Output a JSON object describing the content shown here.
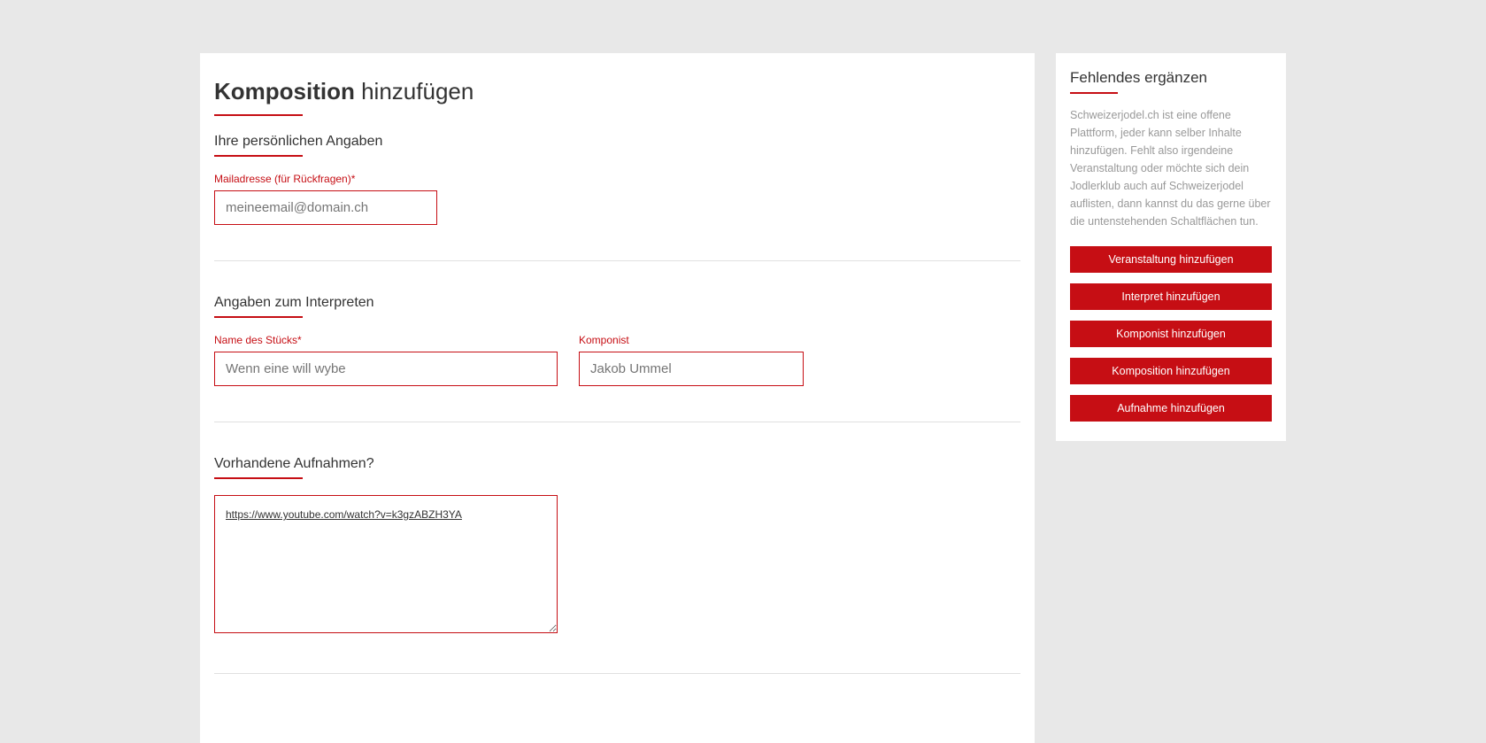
{
  "page": {
    "title_bold": "Komposition",
    "title_rest": " hinzufügen"
  },
  "section1": {
    "heading": "Ihre persönlichen Angaben",
    "email_label": "Mailadresse (für Rückfragen)*",
    "email_placeholder": "meineemail@domain.ch"
  },
  "section2": {
    "heading": "Angaben zum Interpreten",
    "piece_label": "Name des Stücks*",
    "piece_placeholder": "Wenn eine will wybe",
    "composer_label": "Komponist",
    "composer_placeholder": "Jakob Ummel"
  },
  "section3": {
    "heading": "Vorhandene Aufnahmen?",
    "textarea_value": "https://www.youtube.com/watch?v=k3gzABZH3YA"
  },
  "sidebar": {
    "heading": "Fehlendes ergänzen",
    "text": "Schweizerjodel.ch ist eine offene Plattform, jeder kann selber Inhalte hinzufügen. Fehlt also irgendeine Veranstaltung oder möchte sich dein Jodlerklub auch auf Schweizerjodel auflisten, dann kannst du das gerne über die untenstehenden Schaltflächen tun.",
    "buttons": [
      "Veranstaltung hinzufügen",
      "Interpret hinzufügen",
      "Komponist hinzufügen",
      "Komposition hinzufügen",
      "Aufnahme hinzufügen"
    ]
  }
}
